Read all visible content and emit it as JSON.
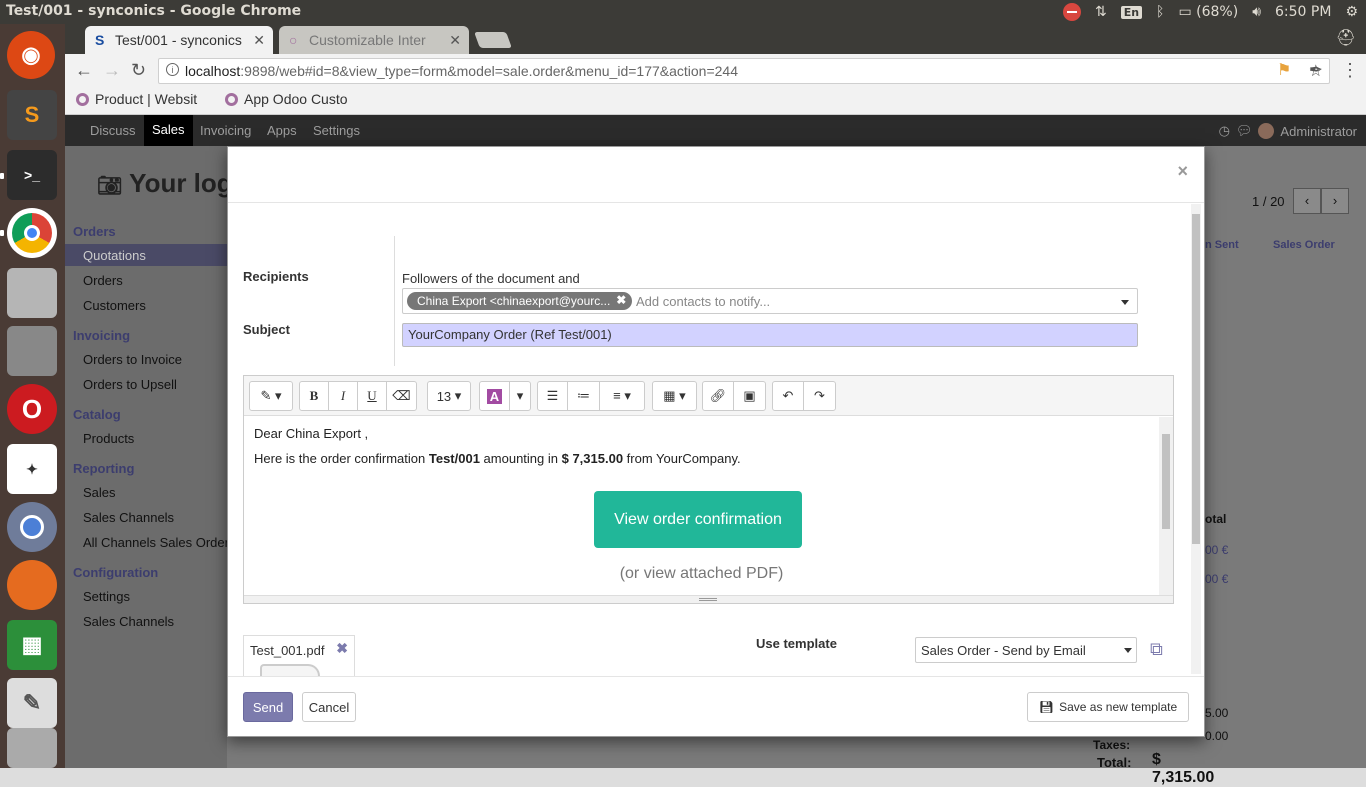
{
  "os": {
    "window_title": "Test/001 - synconics - Google Chrome",
    "lang": "En",
    "battery": "(68%)",
    "clock": "6:50 PM"
  },
  "browser": {
    "tabs": [
      {
        "label": "Test/001 - synconics",
        "favicon": "S"
      },
      {
        "label": "Customizable Inter"
      }
    ],
    "url_host": "localhost",
    "url_rest": ":9898/web#id=8&view_type=form&model=sale.order&menu_id=177&action=244",
    "bookmarks": [
      {
        "label": "Product | Websit"
      },
      {
        "label": "App Odoo Custo"
      }
    ]
  },
  "odoo_nav": {
    "menus": [
      "Discuss",
      "Sales",
      "Invoicing",
      "Apps",
      "Settings"
    ],
    "user": "Administrator"
  },
  "sidebar": {
    "sections": [
      {
        "title": "Orders",
        "items": [
          "Quotations",
          "Orders",
          "Customers"
        ]
      },
      {
        "title": "Invoicing",
        "items": [
          "Orders to Invoice",
          "Orders to Upsell"
        ]
      },
      {
        "title": "Catalog",
        "items": [
          "Products"
        ]
      },
      {
        "title": "Reporting",
        "items": [
          "Sales",
          "Sales Channels",
          "All Channels Sales Orders"
        ]
      },
      {
        "title": "Configuration",
        "items": [
          "Settings",
          "Sales Channels"
        ]
      }
    ]
  },
  "background": {
    "title": "Your log",
    "pager": "1 / 20",
    "status_1": "n Sent",
    "status_2": "Sales Order",
    "col_header": "otal",
    "amount_1": "00 €",
    "amount_2": "00 €",
    "sub_1": "5.00",
    "taxes_label": "Taxes:",
    "taxes_val": "0.00",
    "total_label": "Total:",
    "total_val": "$ 7,315.00"
  },
  "modal": {
    "close": "×",
    "recipients_label": "Recipients",
    "followers_text": "Followers of the document and",
    "recipient_tag": "China Export <chinaexport@yourc...",
    "recipient_placeholder": "Add contacts to notify...",
    "subject_label": "Subject",
    "subject_value": "YourCompany Order (Ref Test/001)",
    "toolbar": {
      "font_size": "13"
    },
    "body": {
      "greeting": "Dear China Export ,",
      "line_pre": "Here is the order confirmation ",
      "order_ref": "Test/001",
      "line_mid": " amounting in ",
      "amount": "$ 7,315.00",
      "line_post": " from YourCompany.",
      "cta": "View order confirmation",
      "pdf_hint": "(or view attached PDF)"
    },
    "attachment": "Test_001.pdf",
    "template_label": "Use template",
    "template_value": "Sales Order - Send by Email",
    "send": "Send",
    "cancel": "Cancel",
    "save_template": "Save as new template"
  }
}
